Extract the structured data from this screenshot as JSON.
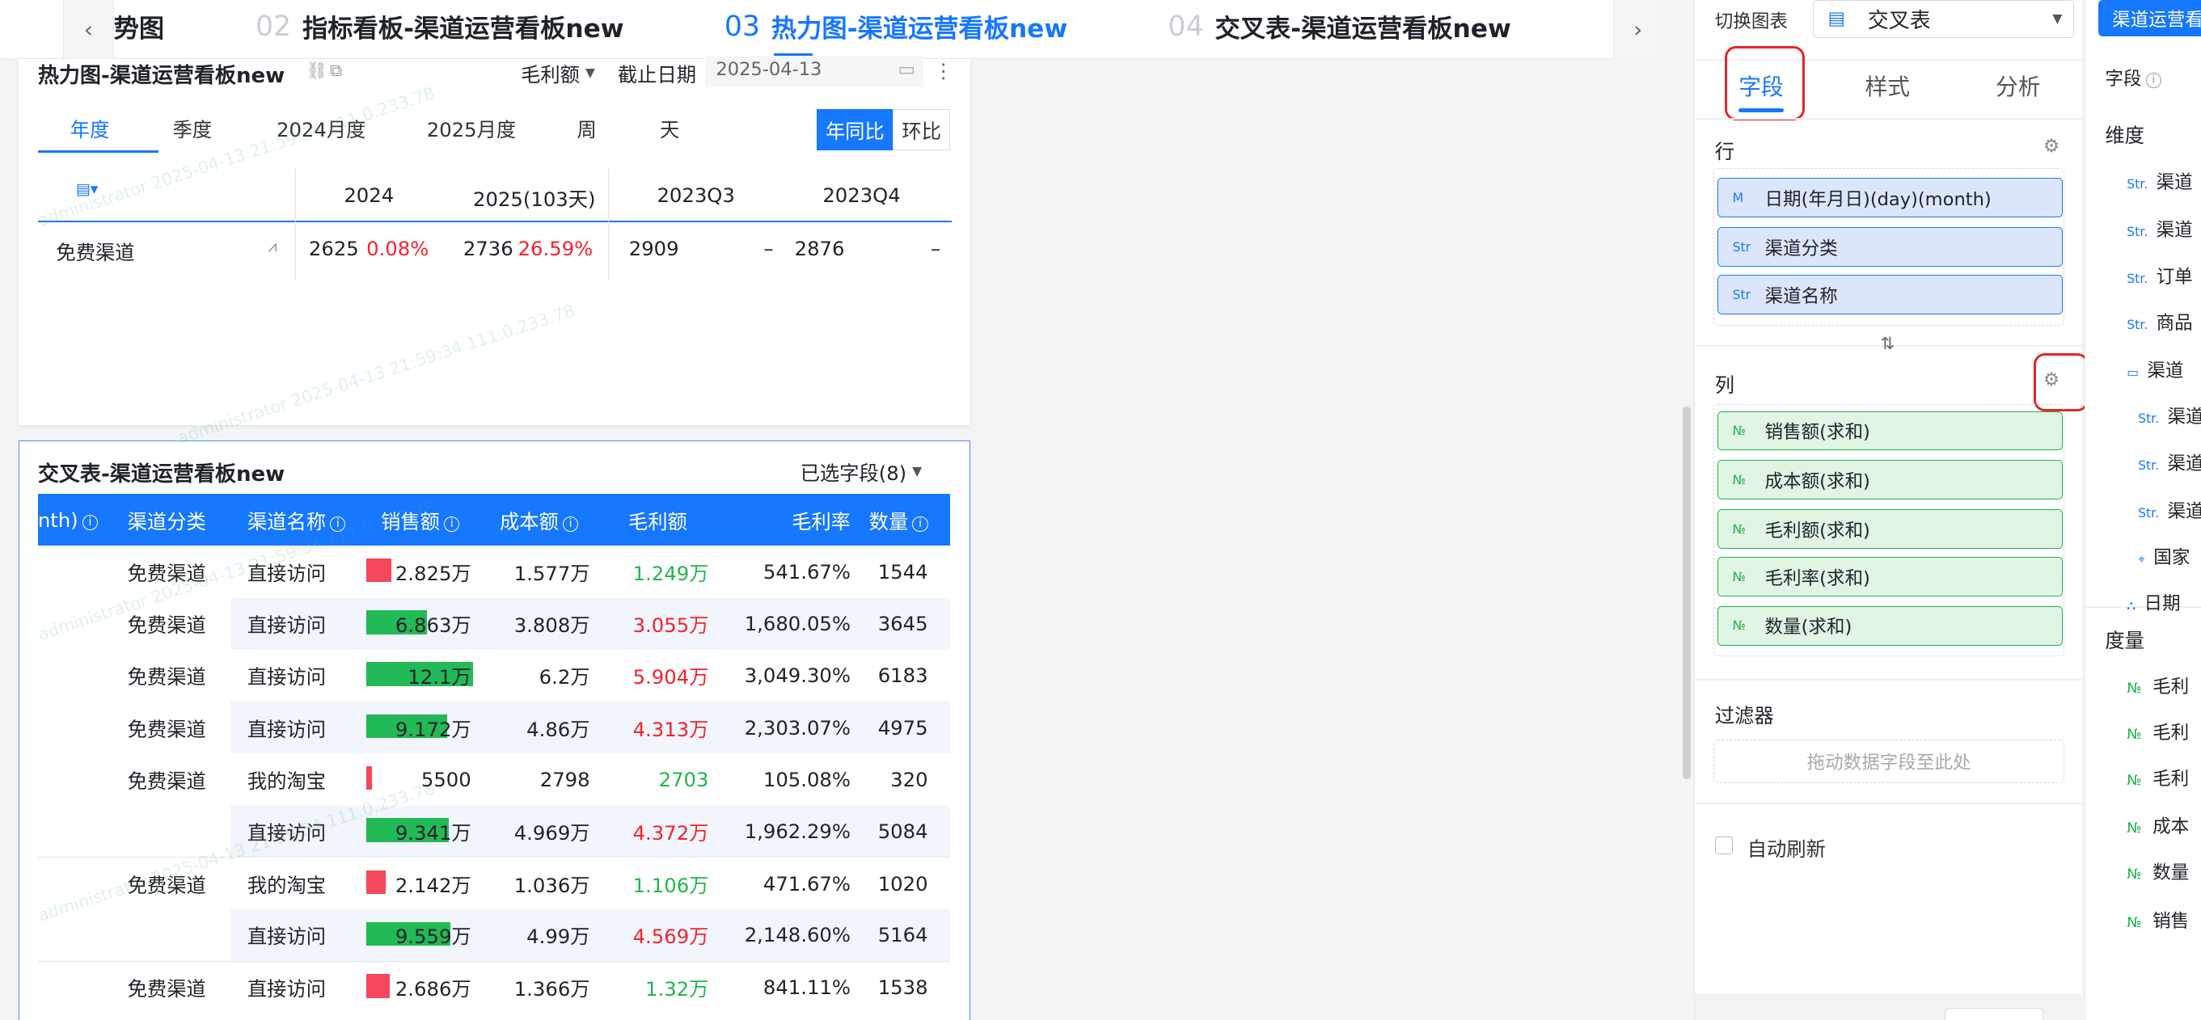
{
  "tabs": [
    {
      "num": "",
      "label": "势图"
    },
    {
      "num": "02",
      "label": "指标看板-渠道运营看板new"
    },
    {
      "num": "03",
      "label": "热力图-渠道运营看板new"
    },
    {
      "num": "04",
      "label": "交叉表-渠道运营看板new"
    }
  ],
  "heatmap": {
    "title": "热力图-渠道运营看板new",
    "metric": "毛利额",
    "date_label": "截止日期",
    "date_value": "2025-04-13",
    "periods": [
      "年度",
      "季度",
      "2024月度",
      "2025月度",
      "周",
      "天"
    ],
    "compare": [
      "年同比",
      "环比"
    ],
    "columns": [
      "2024",
      "2025(103天)",
      "2023Q3",
      "2023Q4"
    ],
    "row": {
      "label": "免费渠道",
      "v1": "2625",
      "p1": "0.08%",
      "v2": "2736",
      "p2": "26.59%",
      "v3": "2909",
      "p3": "–",
      "v4": "2876",
      "p4": "–"
    }
  },
  "cross": {
    "title": "交叉表-渠道运营看板new",
    "selected": "已选字段(8)",
    "headers": [
      "nth)",
      "渠道分类",
      "渠道名称",
      "销售额",
      "成本额",
      "毛利额",
      "毛利率",
      "数量"
    ],
    "rows": [
      {
        "cat": "免费渠道",
        "name": "直接访问",
        "sales": "2.825万",
        "salesFrac": 0.23,
        "salesColor": "#f4475a",
        "cost": "1.577万",
        "gross": "1.249万",
        "grossColor": "#20b74a",
        "rate": "541.67%",
        "qty": "1544"
      },
      {
        "cat": "免费渠道",
        "name": "直接访问",
        "sales": "6.863万",
        "salesFrac": 0.57,
        "salesColor": "#22b957",
        "cost": "3.808万",
        "gross": "3.055万",
        "grossColor": "#f5222d",
        "rate": "1,680.05%",
        "qty": "3645"
      },
      {
        "cat": "免费渠道",
        "name": "直接访问",
        "sales": "12.1万",
        "salesFrac": 1.0,
        "salesColor": "#22b957",
        "cost": "6.2万",
        "gross": "5.904万",
        "grossColor": "#f5222d",
        "rate": "3,049.30%",
        "qty": "6183"
      },
      {
        "cat": "免费渠道",
        "name": "直接访问",
        "sales": "9.172万",
        "salesFrac": 0.76,
        "salesColor": "#22b957",
        "cost": "4.86万",
        "gross": "4.313万",
        "grossColor": "#f5222d",
        "rate": "2,303.07%",
        "qty": "4975"
      },
      {
        "cat": "免费渠道",
        "name": "我的淘宝",
        "sales": "5500",
        "salesFrac": 0.05,
        "salesColor": "#f4475a",
        "cost": "2798",
        "gross": "2703",
        "grossColor": "#20b74a",
        "rate": "105.08%",
        "qty": "320"
      },
      {
        "cat": "",
        "name": "直接访问",
        "sales": "9.341万",
        "salesFrac": 0.77,
        "salesColor": "#22b957",
        "cost": "4.969万",
        "gross": "4.372万",
        "grossColor": "#f5222d",
        "rate": "1,962.29%",
        "qty": "5084"
      },
      {
        "cat": "免费渠道",
        "name": "我的淘宝",
        "sales": "2.142万",
        "salesFrac": 0.18,
        "salesColor": "#f4475a",
        "cost": "1.036万",
        "gross": "1.106万",
        "grossColor": "#20b74a",
        "rate": "471.67%",
        "qty": "1020"
      },
      {
        "cat": "",
        "name": "直接访问",
        "sales": "9.559万",
        "salesFrac": 0.79,
        "salesColor": "#22b957",
        "cost": "4.99万",
        "gross": "4.569万",
        "grossColor": "#f5222d",
        "rate": "2,148.60%",
        "qty": "5164"
      },
      {
        "cat": "免费渠道",
        "name": "直接访问",
        "sales": "2.686万",
        "salesFrac": 0.22,
        "salesColor": "#f4475a",
        "cost": "1.366万",
        "gross": "1.32万",
        "grossColor": "#20b74a",
        "rate": "841.11%",
        "qty": "1538"
      }
    ]
  },
  "panel": {
    "switch_label": "切换图表",
    "chart_type": "交叉表",
    "tabs": [
      "字段",
      "样式",
      "分析"
    ],
    "row_title": "行",
    "row_fields": [
      {
        "type": "M",
        "label": "日期(年月日)(day)(month)"
      },
      {
        "type": "Str",
        "label": "渠道分类"
      },
      {
        "type": "Str",
        "label": "渠道名称"
      }
    ],
    "col_title": "列",
    "col_fields": [
      {
        "type": "№",
        "label": "销售额(求和)"
      },
      {
        "type": "№",
        "label": "成本额(求和)"
      },
      {
        "type": "№",
        "label": "毛利额(求和)"
      },
      {
        "type": "№",
        "label": "毛利率(求和)"
      },
      {
        "type": "№",
        "label": "数量(求和)"
      }
    ],
    "filter_title": "过滤器",
    "filter_placeholder": "拖动数据字段至此处",
    "auto_refresh": "自动刷新"
  },
  "far": {
    "top_button": "渠道运营看",
    "field_label": "字段",
    "dim_title": "维度",
    "dims": [
      "渠道",
      "渠道",
      "订单",
      "商品",
      "渠道",
      "渠道",
      "渠道",
      "渠道",
      "国家",
      "日期"
    ],
    "measure_title": "度量",
    "measures": [
      "毛利",
      "毛利",
      "毛利",
      "成本",
      "数量",
      "销售"
    ]
  },
  "watermark": "administrator 2025-04-13 21:59:34 111.0.233.78"
}
